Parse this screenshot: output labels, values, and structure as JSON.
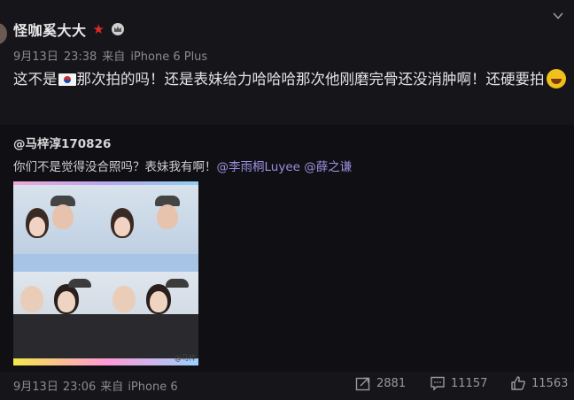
{
  "post": {
    "author": "怪咖奚大大",
    "date": "9月13日",
    "time": "23:38",
    "via": "来自",
    "device": "iPhone 6 Plus",
    "content_before_flag": "这不是",
    "content_after_flag": "那次拍的吗！还是表妹给力哈哈哈那次他刚磨完骨还没消肿啊！还硬要拍"
  },
  "repost": {
    "author": "@马梓淳170826",
    "text": "你们不是觉得没合照吗？表妹我有啊！",
    "mention_1": "@李雨桐Luyee",
    "mention_2": "@薛之谦",
    "image_watermark": "@马梓",
    "date": "9月13日",
    "time": "23:06",
    "via": "来自",
    "device": "iPhone 6",
    "reposts": "2881",
    "comments": "11157",
    "likes": "11563"
  },
  "colors": {
    "background": "#15151a",
    "mention": "#9a8fe0",
    "badge_red": "#e02b20"
  },
  "icons": [
    "star-badge-icon",
    "crown-badge-icon",
    "chevron-down-icon",
    "korea-flag-emoji",
    "laugh-cry-emoji",
    "repost-icon",
    "comment-icon",
    "like-icon"
  ]
}
